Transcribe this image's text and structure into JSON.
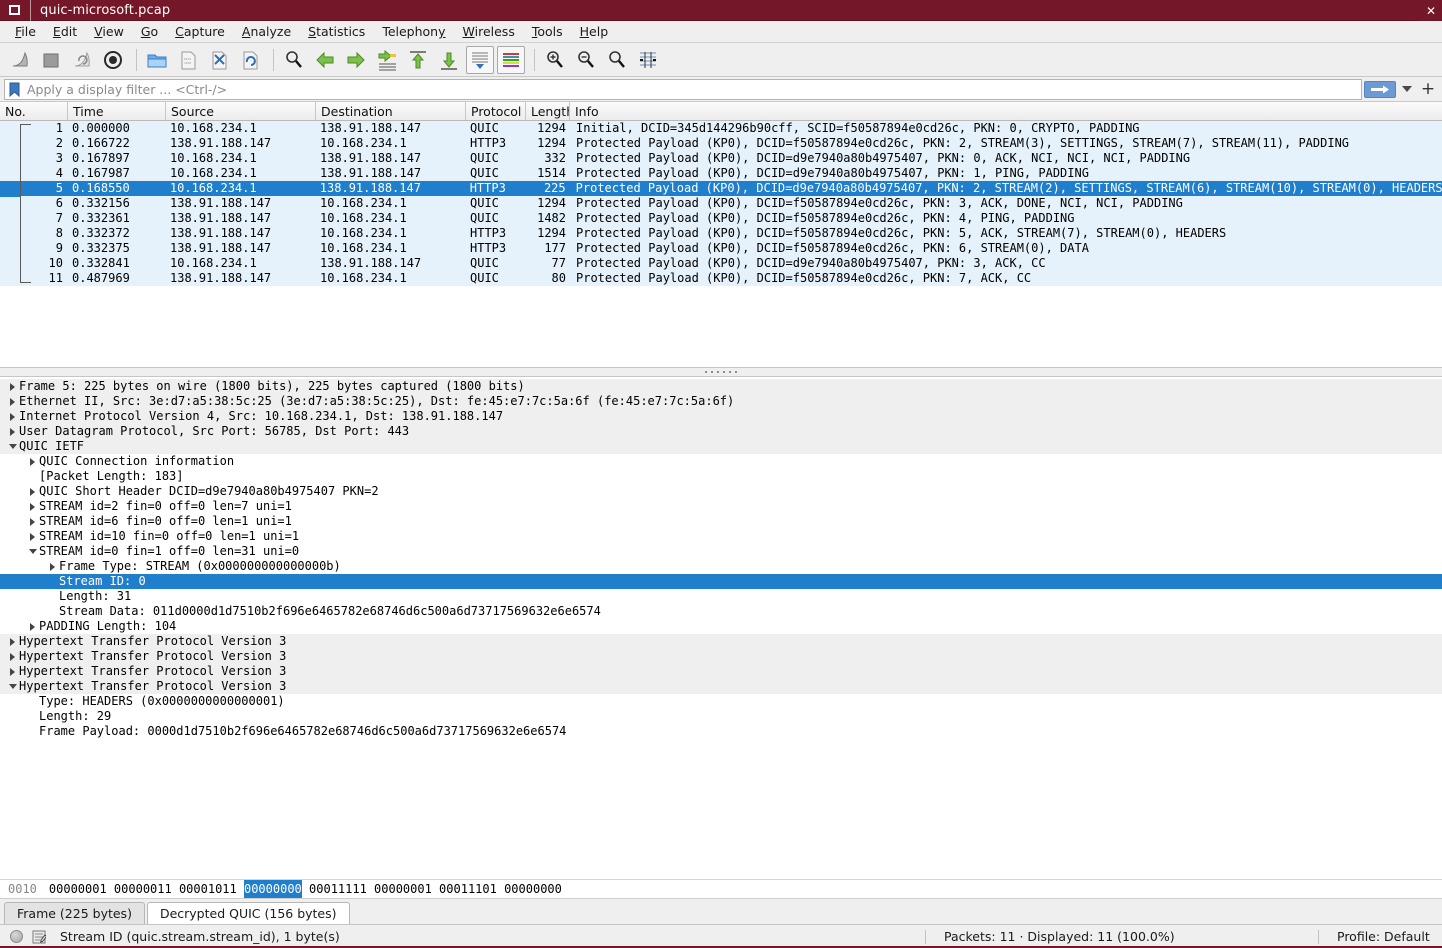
{
  "window": {
    "title": "quic-microsoft.pcap",
    "sysicon": "window-restore-icon",
    "close_label": "close-icon"
  },
  "menu": {
    "items": [
      {
        "label": "File",
        "mnemonic": "F"
      },
      {
        "label": "Edit",
        "mnemonic": "E"
      },
      {
        "label": "View",
        "mnemonic": "V"
      },
      {
        "label": "Go",
        "mnemonic": "G"
      },
      {
        "label": "Capture",
        "mnemonic": "C"
      },
      {
        "label": "Analyze",
        "mnemonic": "A"
      },
      {
        "label": "Statistics",
        "mnemonic": "S"
      },
      {
        "label": "Telephony",
        "mnemonic": "y"
      },
      {
        "label": "Wireless",
        "mnemonic": "W"
      },
      {
        "label": "Tools",
        "mnemonic": "T"
      },
      {
        "label": "Help",
        "mnemonic": "H"
      }
    ]
  },
  "toolbar": {
    "buttons": [
      "start-capture-icon",
      "stop-capture-icon",
      "restart-capture-icon",
      "capture-options-icon",
      "open-file-icon",
      "save-file-icon",
      "close-file-icon",
      "reload-file-icon",
      "find-packet-icon",
      "go-back-icon",
      "go-forward-icon",
      "go-to-packet-icon",
      "go-to-first-icon",
      "go-to-last-icon",
      "auto-scroll-icon",
      "colorize-icon",
      "zoom-in-icon",
      "zoom-out-icon",
      "zoom-reset-icon",
      "resize-columns-icon"
    ]
  },
  "filter": {
    "placeholder": "Apply a display filter ... <Ctrl-/>",
    "value": "",
    "bookmark_icon": "bookmark-icon",
    "apply_icon": "apply-filter-arrow-icon",
    "dropdown_icon": "chevron-down-icon",
    "add_icon": "add-filter-button"
  },
  "packet_list": {
    "columns": [
      {
        "label": "No."
      },
      {
        "label": "Time"
      },
      {
        "label": "Source"
      },
      {
        "label": "Destination"
      },
      {
        "label": "Protocol"
      },
      {
        "label": "Length"
      },
      {
        "label": "Info"
      }
    ],
    "rows": [
      {
        "no": "1",
        "time": "0.000000",
        "src": "10.168.234.1",
        "dst": "138.91.188.147",
        "proto": "QUIC",
        "len": "1294",
        "info": "Initial, DCID=345d144296b90cff, SCID=f50587894e0cd26c, PKN: 0, CRYPTO, PADDING",
        "selected": false
      },
      {
        "no": "2",
        "time": "0.166722",
        "src": "138.91.188.147",
        "dst": "10.168.234.1",
        "proto": "HTTP3",
        "len": "1294",
        "info": "Protected Payload (KP0), DCID=f50587894e0cd26c, PKN: 2, STREAM(3), SETTINGS, STREAM(7), STREAM(11), PADDING",
        "selected": false
      },
      {
        "no": "3",
        "time": "0.167897",
        "src": "10.168.234.1",
        "dst": "138.91.188.147",
        "proto": "QUIC",
        "len": "332",
        "info": "Protected Payload (KP0), DCID=d9e7940a80b4975407, PKN: 0, ACK, NCI, NCI, NCI, PADDING",
        "selected": false
      },
      {
        "no": "4",
        "time": "0.167987",
        "src": "10.168.234.1",
        "dst": "138.91.188.147",
        "proto": "QUIC",
        "len": "1514",
        "info": "Protected Payload (KP0), DCID=d9e7940a80b4975407, PKN: 1, PING, PADDING",
        "selected": false
      },
      {
        "no": "5",
        "time": "0.168550",
        "src": "10.168.234.1",
        "dst": "138.91.188.147",
        "proto": "HTTP3",
        "len": "225",
        "info": "Protected Payload (KP0), DCID=d9e7940a80b4975407, PKN: 2, STREAM(2), SETTINGS, STREAM(6), STREAM(10), STREAM(0), HEADERS",
        "selected": true
      },
      {
        "no": "6",
        "time": "0.332156",
        "src": "138.91.188.147",
        "dst": "10.168.234.1",
        "proto": "QUIC",
        "len": "1294",
        "info": "Protected Payload (KP0), DCID=f50587894e0cd26c, PKN: 3, ACK, DONE, NCI, NCI, PADDING",
        "selected": false
      },
      {
        "no": "7",
        "time": "0.332361",
        "src": "138.91.188.147",
        "dst": "10.168.234.1",
        "proto": "QUIC",
        "len": "1482",
        "info": "Protected Payload (KP0), DCID=f50587894e0cd26c, PKN: 4, PING, PADDING",
        "selected": false
      },
      {
        "no": "8",
        "time": "0.332372",
        "src": "138.91.188.147",
        "dst": "10.168.234.1",
        "proto": "HTTP3",
        "len": "1294",
        "info": "Protected Payload (KP0), DCID=f50587894e0cd26c, PKN: 5, ACK, STREAM(7), STREAM(0), HEADERS",
        "selected": false
      },
      {
        "no": "9",
        "time": "0.332375",
        "src": "138.91.188.147",
        "dst": "10.168.234.1",
        "proto": "HTTP3",
        "len": "177",
        "info": "Protected Payload (KP0), DCID=f50587894e0cd26c, PKN: 6, STREAM(0), DATA",
        "selected": false
      },
      {
        "no": "10",
        "time": "0.332841",
        "src": "10.168.234.1",
        "dst": "138.91.188.147",
        "proto": "QUIC",
        "len": "77",
        "info": "Protected Payload (KP0), DCID=d9e7940a80b4975407, PKN: 3, ACK, CC",
        "selected": false
      },
      {
        "no": "11",
        "time": "0.487969",
        "src": "138.91.188.147",
        "dst": "10.168.234.1",
        "proto": "QUIC",
        "len": "80",
        "info": "Protected Payload (KP0), DCID=f50587894e0cd26c, PKN: 7, ACK, CC",
        "selected": false
      }
    ]
  },
  "detail_tree": [
    {
      "indent": 0,
      "arrow": "collapsed",
      "shade": true,
      "selected": false,
      "label": "Frame 5: 225 bytes on wire (1800 bits), 225 bytes captured (1800 bits)"
    },
    {
      "indent": 0,
      "arrow": "collapsed",
      "shade": true,
      "selected": false,
      "label": "Ethernet II, Src: 3e:d7:a5:38:5c:25 (3e:d7:a5:38:5c:25), Dst: fe:45:e7:7c:5a:6f (fe:45:e7:7c:5a:6f)"
    },
    {
      "indent": 0,
      "arrow": "collapsed",
      "shade": true,
      "selected": false,
      "label": "Internet Protocol Version 4, Src: 10.168.234.1, Dst: 138.91.188.147"
    },
    {
      "indent": 0,
      "arrow": "collapsed",
      "shade": true,
      "selected": false,
      "label": "User Datagram Protocol, Src Port: 56785, Dst Port: 443"
    },
    {
      "indent": 0,
      "arrow": "expanded",
      "shade": true,
      "selected": false,
      "label": "QUIC IETF"
    },
    {
      "indent": 1,
      "arrow": "collapsed",
      "shade": false,
      "selected": false,
      "label": "QUIC Connection information"
    },
    {
      "indent": 1,
      "arrow": "none",
      "shade": false,
      "selected": false,
      "label": "[Packet Length: 183]"
    },
    {
      "indent": 1,
      "arrow": "collapsed",
      "shade": false,
      "selected": false,
      "label": "QUIC Short Header DCID=d9e7940a80b4975407 PKN=2"
    },
    {
      "indent": 1,
      "arrow": "collapsed",
      "shade": false,
      "selected": false,
      "label": "STREAM id=2 fin=0 off=0 len=7 uni=1"
    },
    {
      "indent": 1,
      "arrow": "collapsed",
      "shade": false,
      "selected": false,
      "label": "STREAM id=6 fin=0 off=0 len=1 uni=1"
    },
    {
      "indent": 1,
      "arrow": "collapsed",
      "shade": false,
      "selected": false,
      "label": "STREAM id=10 fin=0 off=0 len=1 uni=1"
    },
    {
      "indent": 1,
      "arrow": "expanded",
      "shade": false,
      "selected": false,
      "label": "STREAM id=0 fin=1 off=0 len=31 uni=0"
    },
    {
      "indent": 2,
      "arrow": "collapsed",
      "shade": false,
      "selected": false,
      "label": "Frame Type: STREAM (0x000000000000000b)"
    },
    {
      "indent": 2,
      "arrow": "none",
      "shade": false,
      "selected": true,
      "label": "Stream ID: 0"
    },
    {
      "indent": 2,
      "arrow": "none",
      "shade": false,
      "selected": false,
      "label": "Length: 31"
    },
    {
      "indent": 2,
      "arrow": "none",
      "shade": false,
      "selected": false,
      "label": "Stream Data: 011d0000d1d7510b2f696e6465782e68746d6c500a6d73717569632e6e6574"
    },
    {
      "indent": 1,
      "arrow": "collapsed",
      "shade": false,
      "selected": false,
      "label": "PADDING Length: 104"
    },
    {
      "indent": 0,
      "arrow": "collapsed",
      "shade": true,
      "selected": false,
      "label": "Hypertext Transfer Protocol Version 3"
    },
    {
      "indent": 0,
      "arrow": "collapsed",
      "shade": true,
      "selected": false,
      "label": "Hypertext Transfer Protocol Version 3"
    },
    {
      "indent": 0,
      "arrow": "collapsed",
      "shade": true,
      "selected": false,
      "label": "Hypertext Transfer Protocol Version 3"
    },
    {
      "indent": 0,
      "arrow": "expanded",
      "shade": true,
      "selected": false,
      "label": "Hypertext Transfer Protocol Version 3"
    },
    {
      "indent": 1,
      "arrow": "none",
      "shade": false,
      "selected": false,
      "label": "Type: HEADERS (0x0000000000000001)"
    },
    {
      "indent": 1,
      "arrow": "none",
      "shade": false,
      "selected": false,
      "label": "Length: 29"
    },
    {
      "indent": 1,
      "arrow": "none",
      "shade": false,
      "selected": false,
      "label": "Frame Payload: 0000d1d7510b2f696e6465782e68746d6c500a6d73717569632e6e6574"
    }
  ],
  "byte_view": {
    "offset": "0010",
    "before": "00000001 00000011 00001011",
    "selected": "00000000",
    "after": "00011111 00000001 00011101 00000000"
  },
  "tabs": [
    {
      "label": "Frame (225 bytes)",
      "active": false
    },
    {
      "label": "Decrypted QUIC (156 bytes)",
      "active": true
    }
  ],
  "status": {
    "expert_icon": "expert-info-icon",
    "note_icon": "capture-comment-icon",
    "field_text": "Stream ID (quic.stream.stream_id), 1 byte(s)",
    "packets_text": "Packets: 11 · Displayed: 11 (100.0%)",
    "profile_text": "Profile: Default"
  },
  "colors": {
    "title_bar": "#741728",
    "selection": "#1f7fcc",
    "packet_row_bg": "#e5f1fb",
    "chrome": "#efefef"
  }
}
